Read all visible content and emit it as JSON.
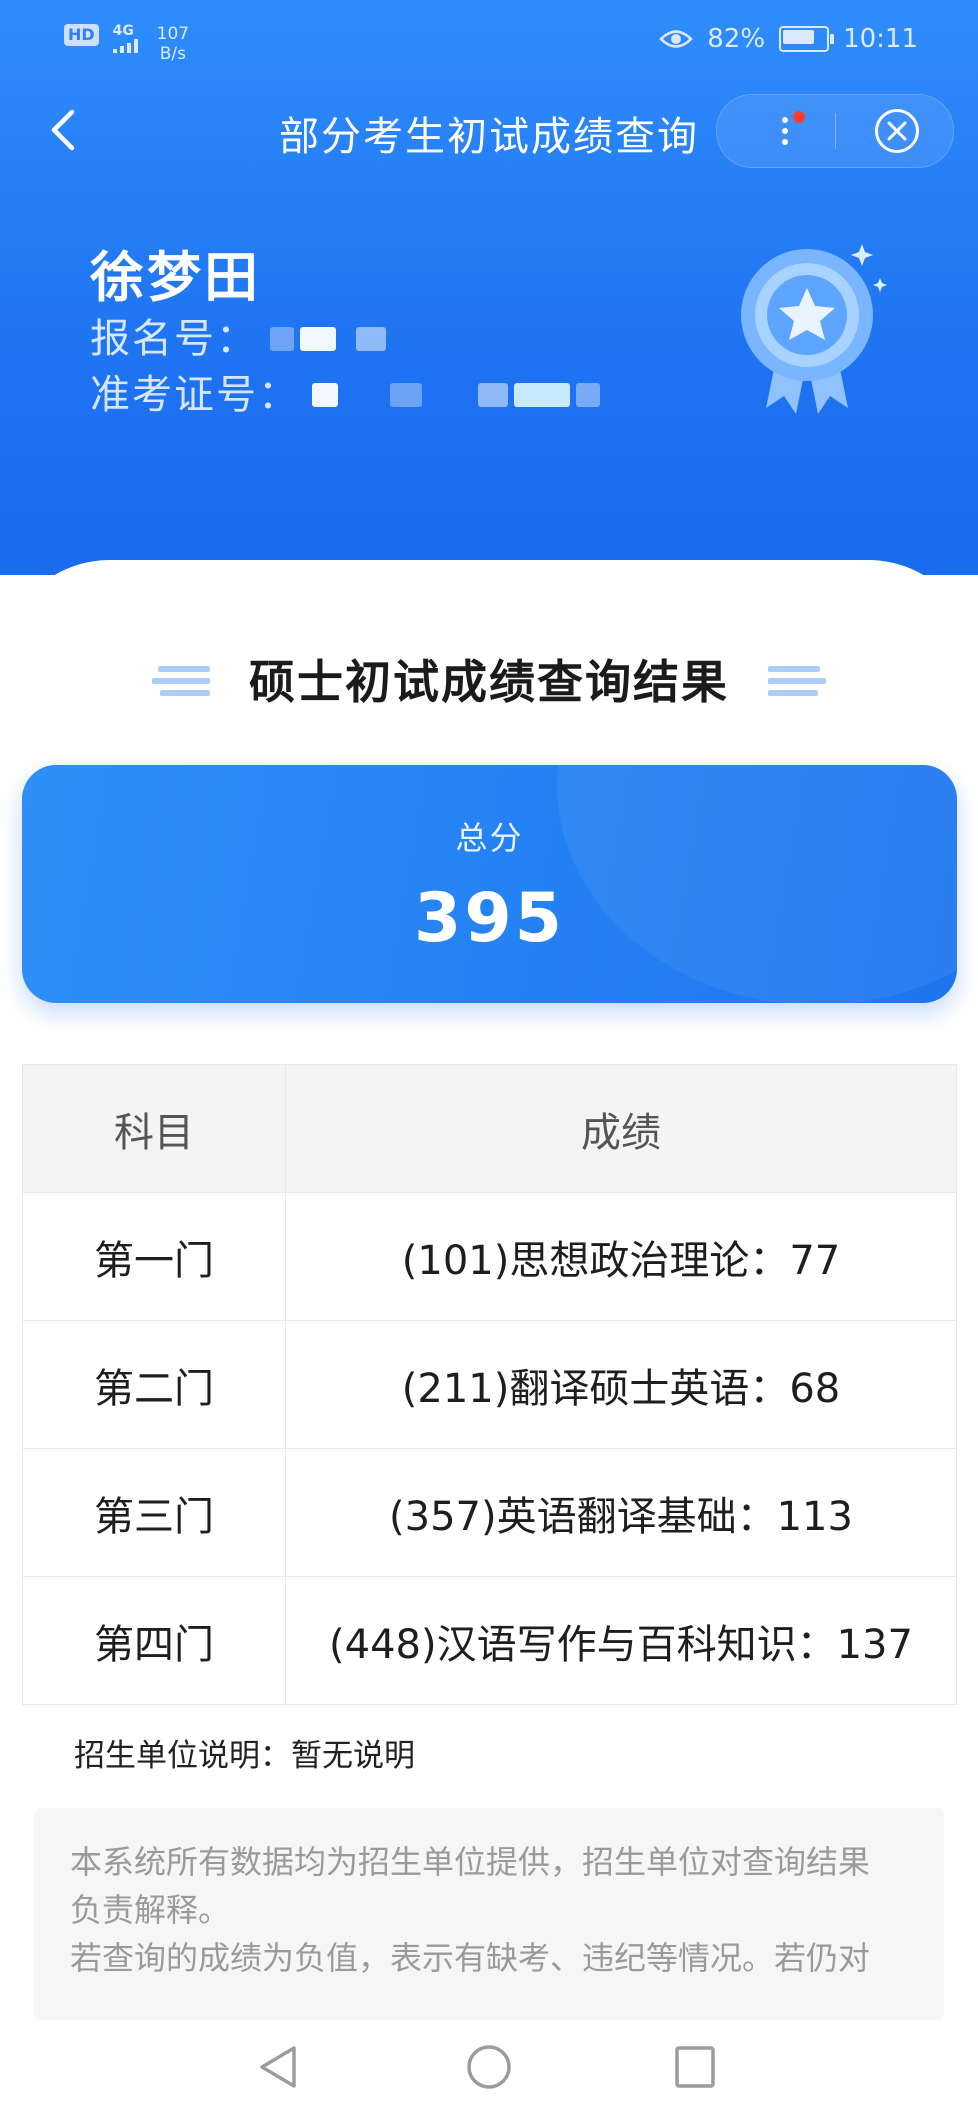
{
  "status_bar": {
    "hd": "HD",
    "network": "4G",
    "speed_value": "107",
    "speed_unit": "B/s",
    "battery": "82%",
    "battery_level": 0.82,
    "time": "10:11"
  },
  "nav": {
    "title": "部分考生初试成绩查询"
  },
  "profile": {
    "name": "徐梦田",
    "reg_label": "报名号：",
    "admission_label": "准考证号："
  },
  "result": {
    "title": "硕士初试成绩查询结果",
    "total_label": "总分",
    "total_value": "395"
  },
  "table": {
    "headers": [
      "科目",
      "成绩"
    ],
    "rows": [
      {
        "subject": "第一门",
        "score": "(101)思想政治理论：77"
      },
      {
        "subject": "第二门",
        "score": "(211)翻译硕士英语：68"
      },
      {
        "subject": "第三门",
        "score": "(357)英语翻译基础：113"
      },
      {
        "subject": "第四门",
        "score": "(448)汉语写作与百科知识：137"
      }
    ]
  },
  "note": "招生单位说明：暂无说明",
  "disclaimer": {
    "line1": "本系统所有数据均为招生单位提供，招生单位对查询结果",
    "line2": "负责解释。",
    "line3": "若查询的成绩为负值，表示有缺考、违纪等情况。若仍对"
  },
  "colors": {
    "primary": "#1f74f2",
    "card": "#2e8ff8",
    "red_dot": "#ff3b30"
  },
  "icons": [
    "back-arrow-icon",
    "more-dots-icon",
    "close-circle-icon",
    "medal-icon",
    "nav-back-icon",
    "nav-home-icon",
    "nav-recents-icon"
  ]
}
